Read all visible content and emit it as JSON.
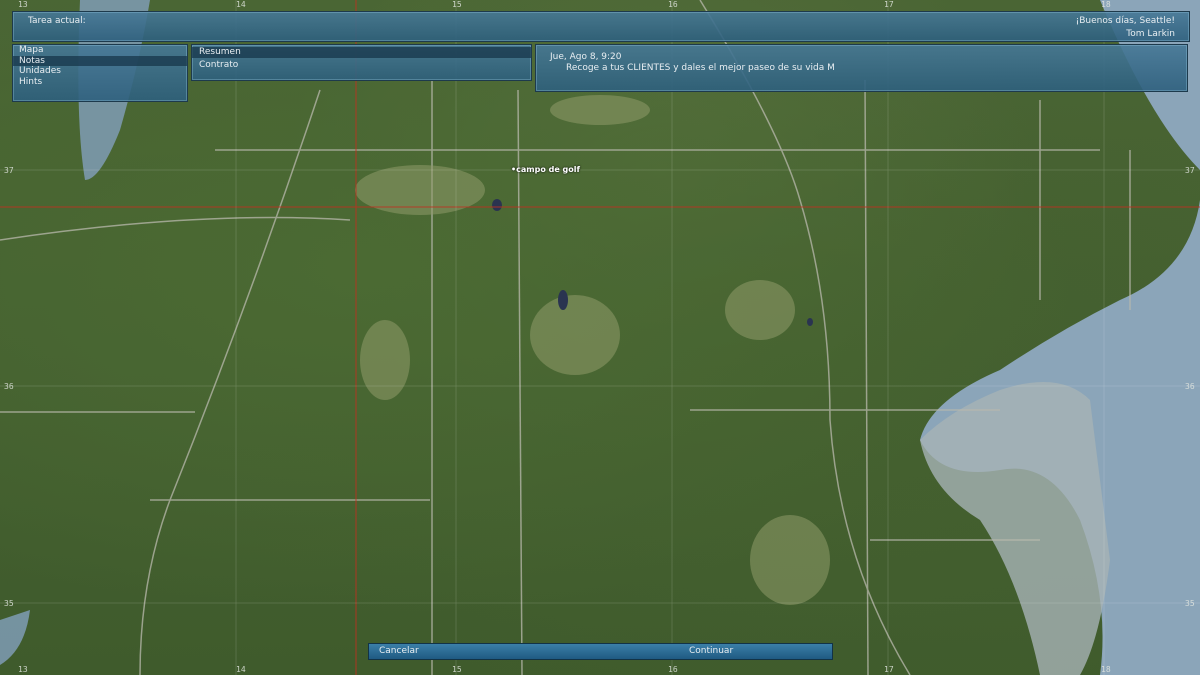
{
  "topbar": {
    "task_label": "Tarea actual:",
    "greeting": "¡Buenos días, Seattle!",
    "user": "Tom Larkin"
  },
  "menu": {
    "items": [
      "Mapa",
      "Notas",
      "Unidades",
      "Hints"
    ],
    "active_index": 1
  },
  "submenu": {
    "items": [
      "Resumen",
      "Contrato"
    ]
  },
  "briefing": {
    "date": "Jue, Ago 8,  9:20",
    "text": "Recoge a tus CLIENTES y dales el mejor paseo de su vida  M"
  },
  "map": {
    "place_label": "•campo de golf",
    "grid_x_labels": [
      "13",
      "14",
      "15",
      "16",
      "17",
      "18"
    ],
    "grid_y_labels": [
      "37",
      "36",
      "35"
    ]
  },
  "buttons": {
    "cancel": "Cancelar",
    "continue": "Continuar"
  },
  "colors": {
    "panel": "#3f7c9e",
    "grid_line": "#c03020",
    "water": "#8aa3b8"
  }
}
